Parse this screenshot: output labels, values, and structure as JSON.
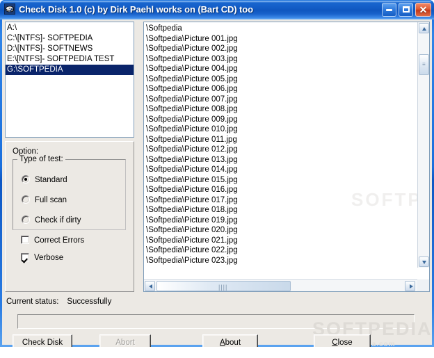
{
  "window": {
    "title": "Check Disk 1.0   (c) by Dirk Paehl works on (Bart CD) too",
    "icon": "disk-check-icon",
    "caption_buttons": {
      "minimize": "minimize-icon",
      "maximize": "maximize-icon",
      "close": "✕"
    }
  },
  "drives": {
    "items": [
      {
        "label": "A:\\",
        "selected": false
      },
      {
        "label": "C:\\[NTFS]- SOFTPEDIA",
        "selected": false
      },
      {
        "label": "D:\\[NTFS]- SOFTNEWS",
        "selected": false
      },
      {
        "label": "E:\\[NTFS]- SOFTPEDIA TEST",
        "selected": false
      },
      {
        "label": "G:\\SOFTPEDIA",
        "selected": true
      }
    ]
  },
  "options": {
    "title": "Option:",
    "group_legend": "Type of test:",
    "radios": [
      {
        "label": "Standard",
        "checked": true
      },
      {
        "label": "Full scan",
        "checked": false
      },
      {
        "label": "Check if dirty",
        "checked": false
      }
    ],
    "checkboxes": [
      {
        "label": "Correct Errors",
        "checked": false
      },
      {
        "label": "Verbose",
        "checked": true
      }
    ]
  },
  "file_list": {
    "items": [
      "\\Softpedia",
      "\\Softpedia\\Picture 001.jpg",
      "\\Softpedia\\Picture 002.jpg",
      "\\Softpedia\\Picture 003.jpg",
      "\\Softpedia\\Picture 004.jpg",
      "\\Softpedia\\Picture 005.jpg",
      "\\Softpedia\\Picture 006.jpg",
      "\\Softpedia\\Picture 007.jpg",
      "\\Softpedia\\Picture 008.jpg",
      "\\Softpedia\\Picture 009.jpg",
      "\\Softpedia\\Picture 010.jpg",
      "\\Softpedia\\Picture 011.jpg",
      "\\Softpedia\\Picture 012.jpg",
      "\\Softpedia\\Picture 013.jpg",
      "\\Softpedia\\Picture 014.jpg",
      "\\Softpedia\\Picture 015.jpg",
      "\\Softpedia\\Picture 016.jpg",
      "\\Softpedia\\Picture 017.jpg",
      "\\Softpedia\\Picture 018.jpg",
      "\\Softpedia\\Picture 019.jpg",
      "\\Softpedia\\Picture 020.jpg",
      "\\Softpedia\\Picture 021.jpg",
      "\\Softpedia\\Picture 022.jpg",
      "\\Softpedia\\Picture 023.jpg"
    ]
  },
  "scrollbars": {
    "vertical": {
      "up_arrow": "scroll-up-icon",
      "thumb_grip": "≡"
    },
    "horizontal": {
      "left_arrow": "❮",
      "right_arrow": "❯",
      "thumb_grip": "||||"
    }
  },
  "status": {
    "label": "Current status:",
    "value": "Successfully"
  },
  "buttons": {
    "check_disk": "Check Disk",
    "abort": "Abort",
    "about_pre": "",
    "about_accel": "A",
    "about_post": "bout",
    "close_accel": "C",
    "close_post": "lose"
  },
  "watermarks": {
    "big": "SOFTPEDIA",
    "small": "www.softpedia.com",
    "list": "SOFTPEDIA"
  },
  "colors": {
    "titlebar_blue": "#0f56bf",
    "selection_blue": "#0a246a",
    "face": "#ece9e4",
    "close_red": "#c3391a",
    "list_border": "#7f9db9"
  }
}
